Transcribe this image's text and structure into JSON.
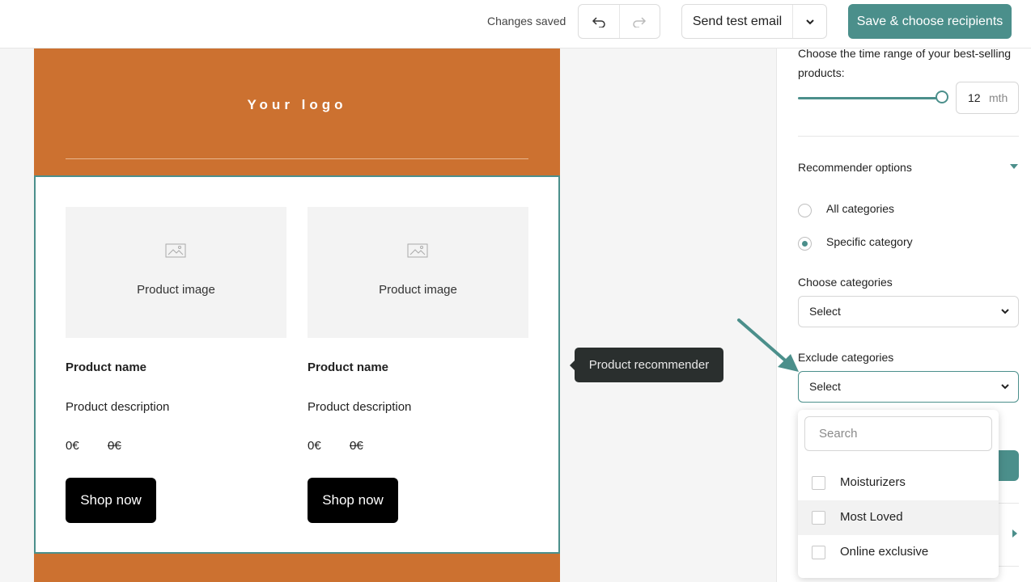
{
  "topbar": {
    "status": "Changes saved",
    "undo_icon": "undo-arrow-icon",
    "redo_icon": "redo-arrow-icon",
    "send_test_label": "Send test email",
    "save_label": "Save & choose recipients",
    "accent": "#4b8f8b"
  },
  "email": {
    "brand_color": "#cc7130",
    "logo_text": "Your logo",
    "products": [
      {
        "image_caption": "Product image",
        "name": "Product name",
        "description": "Product description",
        "price": "0€",
        "old_price": "0€",
        "cta": "Shop now"
      },
      {
        "image_caption": "Product image",
        "name": "Product name",
        "description": "Product description",
        "price": "0€",
        "old_price": "0€",
        "cta": "Shop now"
      }
    ],
    "tooltip": "Product recommender"
  },
  "panel": {
    "time_range_label": "Choose the time range of your best-selling products:",
    "time_range_value": "12",
    "time_range_unit": "mth",
    "recommender_title": "Recommender options",
    "radio_all": "All categories",
    "radio_specific": "Specific category",
    "radio_selected": "Specific category",
    "choose_label": "Choose categories",
    "choose_value": "Select",
    "exclude_label": "Exclude categories",
    "exclude_value": "Select"
  },
  "dropdown": {
    "search_placeholder": "Search",
    "options": [
      "Moisturizers",
      "Most Loved",
      "Online exclusive"
    ],
    "hovered": "Most Loved"
  }
}
